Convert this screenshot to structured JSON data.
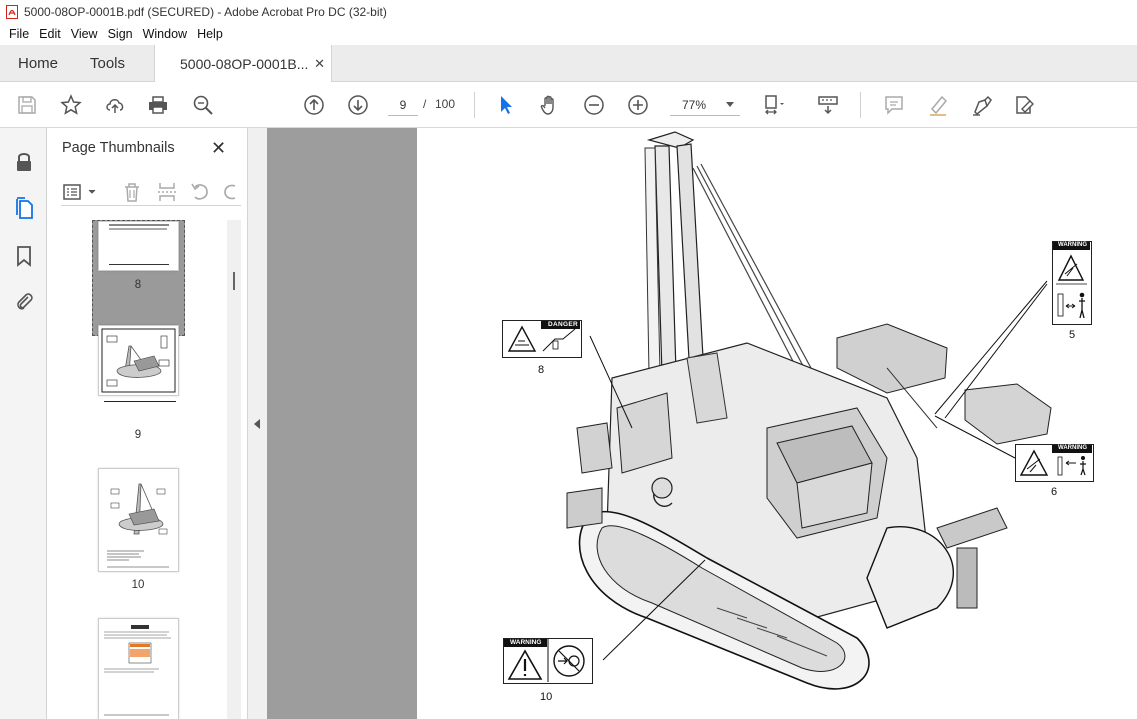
{
  "window": {
    "title": "5000-08OP-0001B.pdf (SECURED) - Adobe Acrobat Pro DC (32-bit)"
  },
  "menu": [
    "File",
    "Edit",
    "View",
    "Sign",
    "Window",
    "Help"
  ],
  "tabs": {
    "home": "Home",
    "tools": "Tools",
    "document": "5000-08OP-0001B..."
  },
  "toolbar": {
    "current_page": "9",
    "page_separator": "/",
    "total_pages": "100",
    "zoom": "77%"
  },
  "thumbnail_panel": {
    "title": "Page Thumbnails",
    "thumbnails": [
      {
        "label": "8"
      },
      {
        "label": "9",
        "selected": true
      },
      {
        "label": "10"
      },
      {
        "label": ""
      }
    ]
  },
  "page": {
    "decals": [
      {
        "number": "8",
        "header": "DANGER"
      },
      {
        "number": "5",
        "header": "WARNING"
      },
      {
        "number": "6",
        "header": "WARNING"
      },
      {
        "number": "10",
        "header": "WARNING"
      }
    ]
  },
  "colors": {
    "accent": "#1473e6",
    "acrobat_red": "#d7221a",
    "canvas_gray": "#9d9d9d"
  }
}
